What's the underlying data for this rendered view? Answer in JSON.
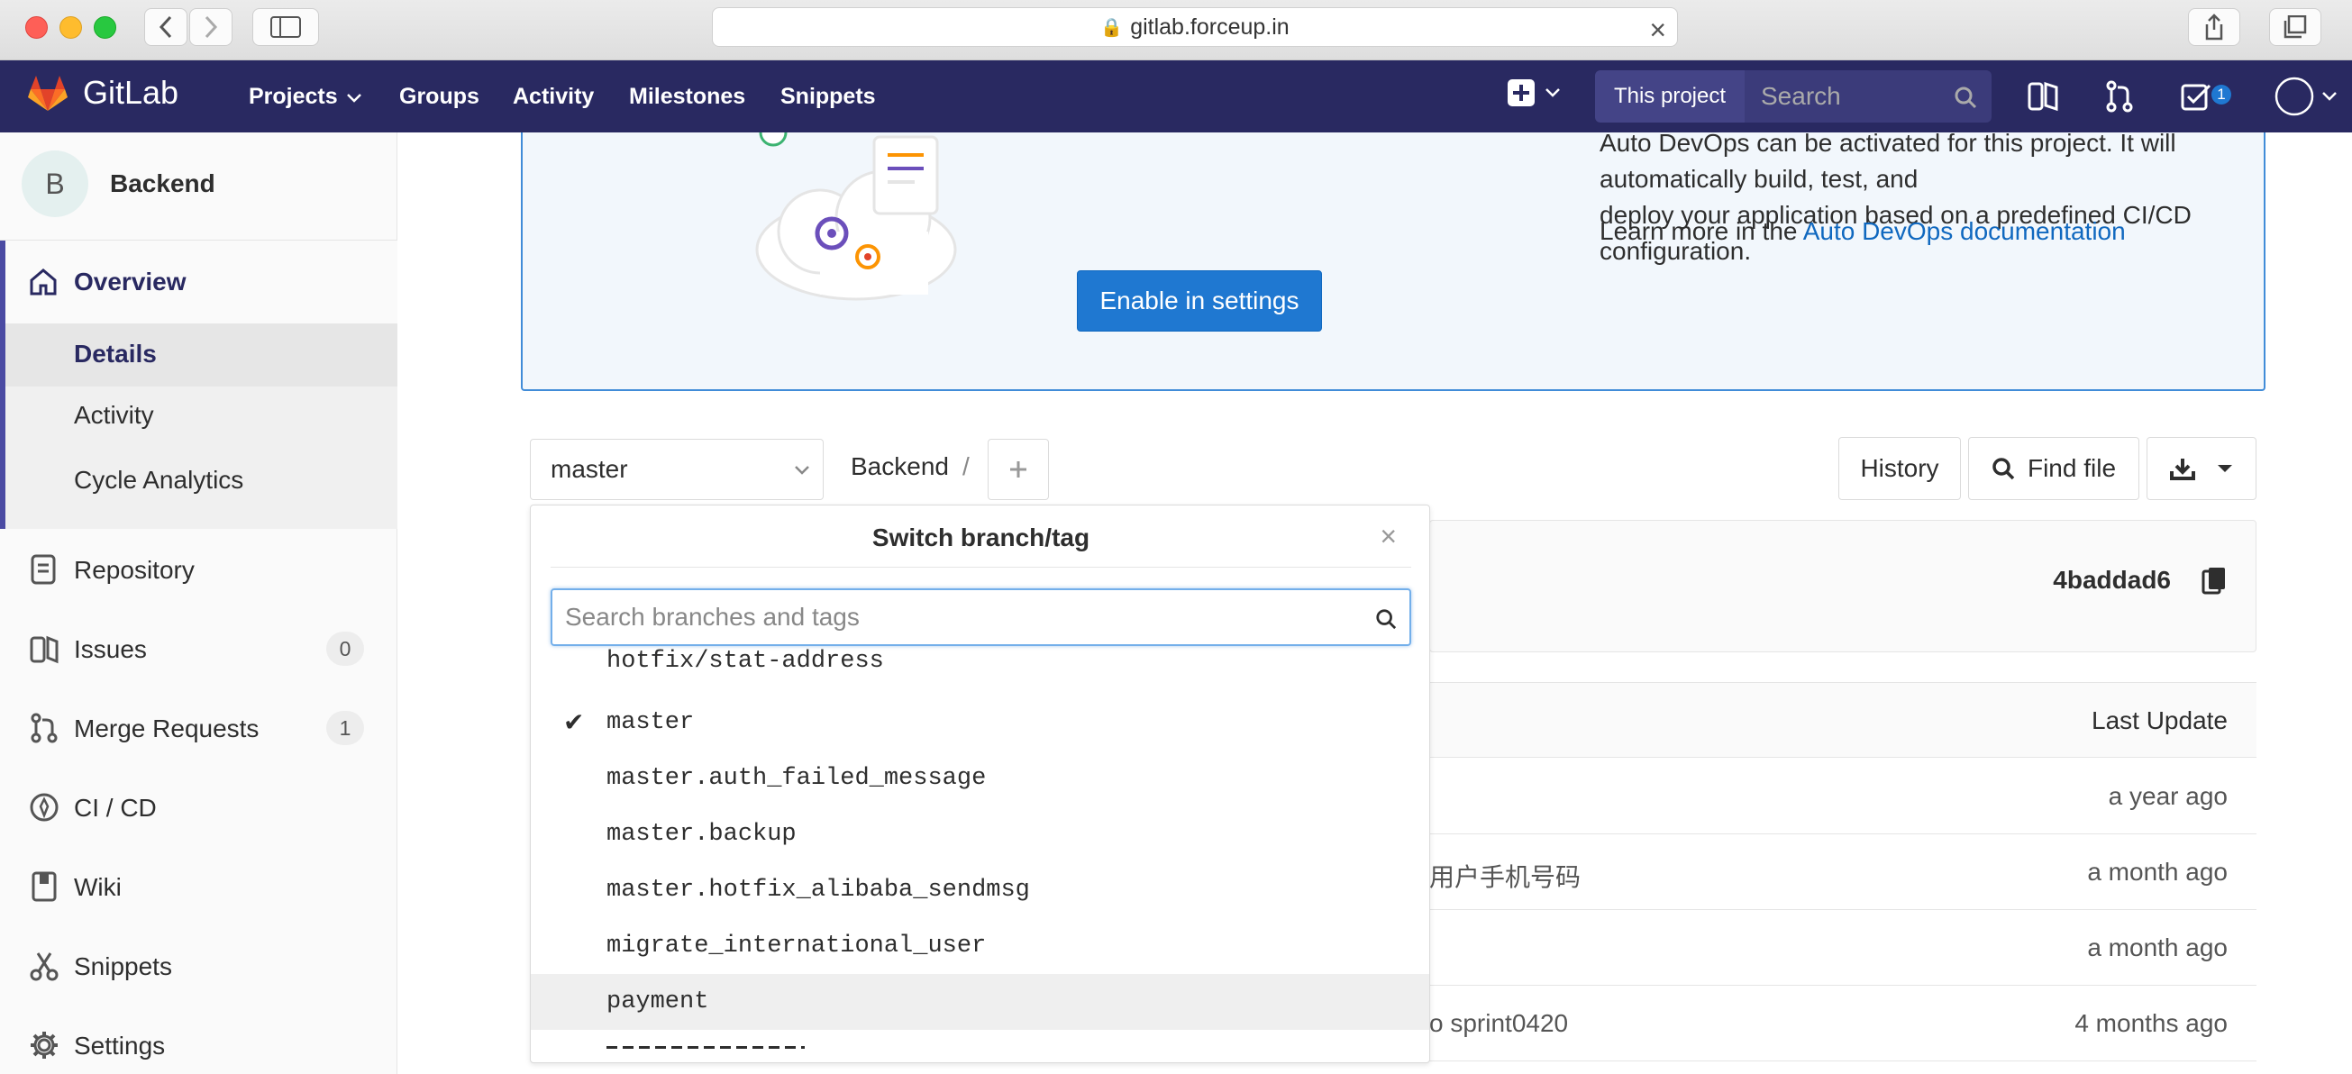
{
  "browser": {
    "url": "gitlab.forceup.in"
  },
  "navbar": {
    "brand": "GitLab",
    "links": [
      "Projects",
      "Groups",
      "Activity",
      "Milestones",
      "Snippets"
    ],
    "search_scope": "This project",
    "search_placeholder": "Search",
    "todo_count": "1"
  },
  "sidebar": {
    "project_initial": "B",
    "project_name": "Backend",
    "overview": "Overview",
    "sub_items": [
      "Details",
      "Activity",
      "Cycle Analytics"
    ],
    "items": [
      {
        "label": "Repository"
      },
      {
        "label": "Issues",
        "count": "0"
      },
      {
        "label": "Merge Requests",
        "count": "1"
      },
      {
        "label": "CI / CD"
      },
      {
        "label": "Wiki"
      },
      {
        "label": "Snippets"
      },
      {
        "label": "Settings"
      }
    ]
  },
  "banner": {
    "line1": "Auto DevOps can be activated for this project. It will automatically build, test, and",
    "line2": "deploy your application based on a predefined CI/CD configuration.",
    "learn_prefix": "Learn more in the ",
    "learn_link": "Auto DevOps documentation",
    "button": "Enable in settings"
  },
  "repo_bar": {
    "branch": "master",
    "breadcrumb": "Backend",
    "breadcrumb_sep": "/",
    "history": "History",
    "find_file": "Find file"
  },
  "commit": {
    "sha": "4baddad6"
  },
  "tree": {
    "header_last_update": "Last Update",
    "rows": [
      {
        "message": "",
        "updated": "a year ago"
      },
      {
        "message": "用户手机号码",
        "updated": "a month ago"
      },
      {
        "message": "",
        "updated": "a month ago"
      },
      {
        "message": "o sprint0420",
        "updated": "4 months ago"
      }
    ]
  },
  "dropdown": {
    "title": "Switch branch/tag",
    "search_placeholder": "Search branches and tags",
    "items": [
      "hotfix/stat-address",
      "master",
      "master.auth_failed_message",
      "master.backup",
      "master.hotfix_alibaba_sendmsg",
      "migrate_international_user",
      "payment"
    ],
    "selected": "master",
    "highlighted": "payment"
  },
  "colors": {
    "navbar": "#292961",
    "accent": "#1f78d1",
    "sidebar_active": "#4b4ba3"
  }
}
